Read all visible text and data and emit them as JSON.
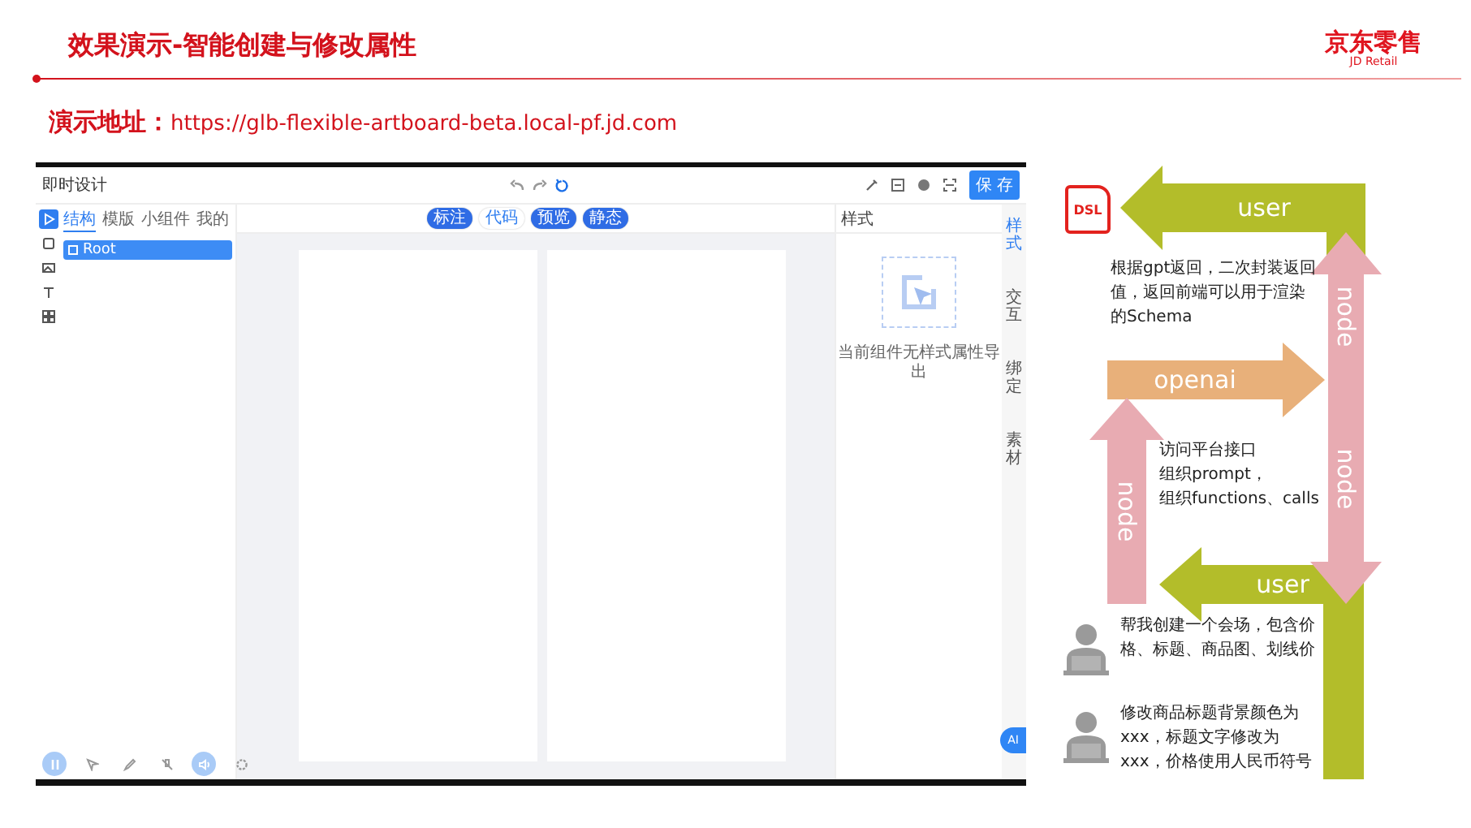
{
  "header": {
    "title": "效果演示-智能创建与修改属性",
    "logo": {
      "name": "京东零售",
      "subtitle": "JD Retail"
    }
  },
  "demo_address": {
    "label": "演示地址：",
    "url": "https://glb-flexible-artboard-beta.local-pf.jd.com"
  },
  "app": {
    "title": "即时设计",
    "save_button": "保 存",
    "rail_tools": [
      {
        "kind": "pointer",
        "selected": true
      },
      {
        "kind": "frame",
        "selected": false
      },
      {
        "kind": "image",
        "selected": false
      },
      {
        "kind": "text",
        "selected": false
      },
      {
        "kind": "grid",
        "selected": false
      }
    ],
    "panel_tabs": [
      {
        "label": "结构",
        "selected": true
      },
      {
        "label": "模版",
        "selected": false
      },
      {
        "label": "小组件",
        "selected": false
      },
      {
        "label": "我的",
        "selected": false
      }
    ],
    "layers": [
      {
        "label": "Root",
        "selected": true
      }
    ],
    "mode_buttons": [
      {
        "label": "标注",
        "active": true
      },
      {
        "label": "代码",
        "active": false
      },
      {
        "label": "预览",
        "active": true
      },
      {
        "label": "静态",
        "active": true
      }
    ],
    "style_panel": {
      "title": "样式",
      "empty_hint": "当前组件无样式属性导出"
    },
    "side_tabs": [
      {
        "label": "样式",
        "selected": true
      },
      {
        "label": "交互",
        "selected": false
      },
      {
        "label": "绑定",
        "selected": false
      },
      {
        "label": "素材",
        "selected": false
      }
    ],
    "bottom_tools": [
      {
        "kind": "pause",
        "active": true
      },
      {
        "kind": "cursor",
        "active": false
      },
      {
        "kind": "pencil",
        "active": false
      },
      {
        "kind": "mic-off",
        "active": false
      },
      {
        "kind": "speaker",
        "active": true
      },
      {
        "kind": "gear",
        "active": false
      }
    ],
    "ai_button": "AI"
  },
  "flow": {
    "dsl_badge": "DSL",
    "arrows": [
      {
        "label": "user",
        "kind": "left",
        "color": "#b3bd2a"
      },
      {
        "label": "node",
        "kind": "up",
        "color": "#e8abb2"
      },
      {
        "label": "openai",
        "kind": "right",
        "color": "#e8b07a"
      },
      {
        "label": "node",
        "kind": "up",
        "color": "#e8abb2"
      },
      {
        "label": "user",
        "kind": "left",
        "color": "#b3bd2a"
      },
      {
        "label": "node",
        "kind": "down",
        "color": "#e8abb2"
      }
    ],
    "notes": [
      {
        "lines": [
          "根据gpt返回，二次封装返回值，返回前端可以用于渲染的Schema"
        ]
      },
      {
        "lines": [
          "访问平台接口",
          "组织prompt，",
          "组织functions、calls"
        ]
      }
    ],
    "user_requests": [
      "帮我创建一个会场，包含价格、标题、商品图、划线价",
      "修改商品标题背景颜色为xxx，标题文字修改为xxx，价格使用人民币符号"
    ]
  }
}
